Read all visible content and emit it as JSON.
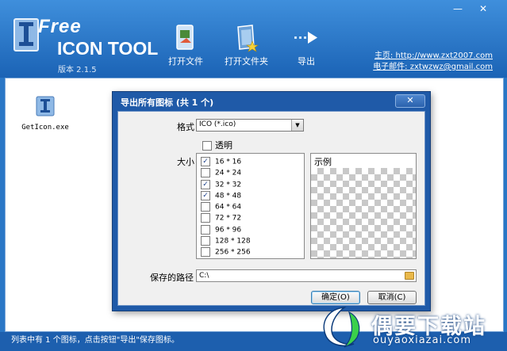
{
  "window": {
    "min_glyph": "—",
    "close_glyph": "✕"
  },
  "logo": {
    "free": "Free",
    "title": "ICON TOOL",
    "version": "版本 2.1.5"
  },
  "toolbar": [
    {
      "label": "打开文件"
    },
    {
      "label": "打开文件夹"
    },
    {
      "label": "导出"
    }
  ],
  "contact": {
    "homepage": "主页: http://www.zxt2007.com",
    "email": "电子邮件: zxtwzwz@gmail.com"
  },
  "files": [
    {
      "name": "GetIcon.exe"
    }
  ],
  "statusbar": {
    "text": "列表中有 1 个图标，点击按钮\"导出\"保存图标。"
  },
  "dialog": {
    "title": "导出所有图标 (共 1 个)",
    "close_glyph": "✕",
    "format_label": "格式",
    "format_value": "ICO (*.ico)",
    "transparent_label": "透明",
    "transparent_checked": false,
    "size_label": "大小",
    "sizes": [
      {
        "label": "16 * 16",
        "checked": true
      },
      {
        "label": "24 * 24",
        "checked": false
      },
      {
        "label": "32 * 32",
        "checked": true
      },
      {
        "label": "48 * 48",
        "checked": true
      },
      {
        "label": "64 * 64",
        "checked": false
      },
      {
        "label": "72 * 72",
        "checked": false
      },
      {
        "label": "96 * 96",
        "checked": false
      },
      {
        "label": "128 * 128",
        "checked": false
      },
      {
        "label": "256 * 256",
        "checked": false
      }
    ],
    "preview_label": "示例",
    "path_label": "保存的路径",
    "path_value": "C:\\",
    "ok_label": "确定(O)",
    "cancel_label": "取消(C)"
  },
  "watermark": {
    "main": "偶要下载站",
    "sub": "ouyaoxiazai.com"
  },
  "colors": {
    "header": "#2f7fd2",
    "dialog_frame": "#1f5aa8",
    "statusbar": "#1d5fae"
  }
}
